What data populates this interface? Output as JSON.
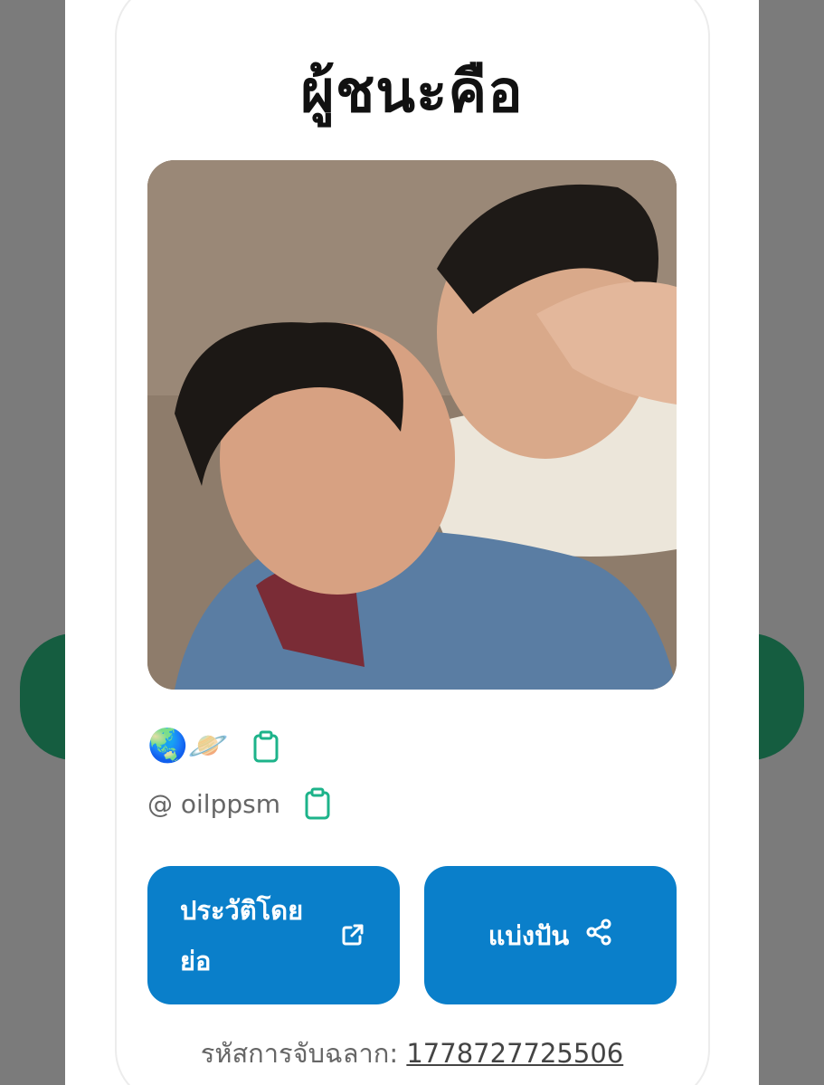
{
  "result": {
    "title": "ผู้ชนะคือ",
    "emoji_name": "🌏🪐",
    "handle": "@ oilppsm",
    "buttons": {
      "bio_label": "ประวัติโดยย่อ",
      "share_label": "แบ่งปัน"
    },
    "draw_code_label": "รหัสการจับฉลาก:",
    "draw_code": "1778727725506"
  },
  "icons": {
    "copy": "clipboard-icon",
    "external": "external-link-icon",
    "share": "share-icon"
  },
  "colors": {
    "accent": "#0a7fca",
    "copy_icon": "#1db38a"
  }
}
